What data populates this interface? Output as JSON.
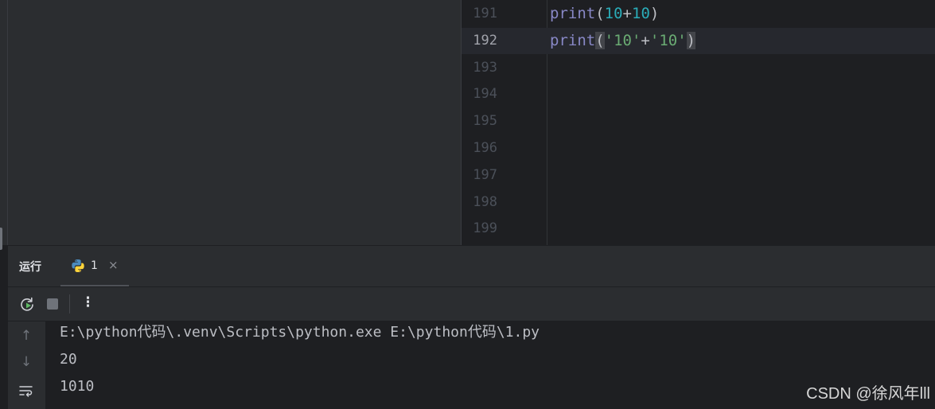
{
  "editor": {
    "lines": [
      {
        "num": "191",
        "tokens": [
          [
            "fn",
            "print"
          ],
          [
            "plain",
            "("
          ],
          [
            "num",
            "10"
          ],
          [
            "plain",
            "+"
          ],
          [
            "num",
            "10"
          ],
          [
            "plain",
            ")"
          ]
        ]
      },
      {
        "num": "192",
        "current": true,
        "tokens": [
          [
            "fn",
            "print"
          ],
          [
            "hl",
            "("
          ],
          [
            "str",
            "'10'"
          ],
          [
            "plain",
            "+"
          ],
          [
            "str",
            "'10'"
          ],
          [
            "hl",
            ")"
          ]
        ]
      },
      {
        "num": "193",
        "tokens": []
      },
      {
        "num": "194",
        "tokens": []
      },
      {
        "num": "195",
        "tokens": []
      },
      {
        "num": "196",
        "tokens": []
      },
      {
        "num": "197",
        "tokens": []
      },
      {
        "num": "198",
        "tokens": []
      },
      {
        "num": "199",
        "tokens": []
      }
    ]
  },
  "run_panel": {
    "title": "运行",
    "tab_label": "1",
    "tab_close": "×",
    "more_label": "⋮"
  },
  "console": {
    "lines": [
      "E:\\python代码\\.venv\\Scripts\\python.exe E:\\python代码\\1.py",
      "20",
      "1010"
    ]
  },
  "icons": {
    "tab": "python-icon",
    "rerun": "rerun-icon",
    "stop": "stop-icon",
    "up": "arrow-up-icon",
    "down": "arrow-down-icon",
    "wrap": "soft-wrap-icon"
  },
  "watermark": "CSDN @徐风年lll"
}
